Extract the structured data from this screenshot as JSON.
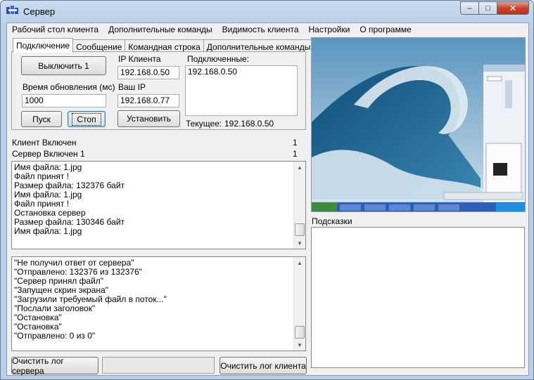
{
  "window": {
    "title": "Сервер"
  },
  "menu": [
    "Рабочий стол клиента",
    "Дополнительные команды",
    "Видимость клиента",
    "Настройки",
    "О программе"
  ],
  "tabs": [
    {
      "label": "Подключение",
      "active": true
    },
    {
      "label": "Сообщение",
      "active": false
    },
    {
      "label": "Командная строка",
      "active": false
    },
    {
      "label": "Дополнительные команды",
      "active": false
    }
  ],
  "connection": {
    "disable_button": "Выключить 1",
    "update_time_label": "Время обновления (мс)",
    "update_time_value": "1000",
    "start_button": "Пуск",
    "stop_button": "Стоп",
    "client_ip_label": "IP Клиента",
    "client_ip_value": "192.168.0.50",
    "your_ip_label": "Ваш IP",
    "your_ip_value": "192.168.0.77",
    "set_button": "Установить",
    "connected_label": "Подключенные:",
    "connected_items": [
      "192.168.0.50"
    ],
    "current_label": "Текущее:",
    "current_value": "192.168.0.50"
  },
  "status": {
    "client_label": "Клиент Включен",
    "client_value": "1",
    "server_label": "Сервер Включен 1",
    "server_value": "1"
  },
  "server_log": [
    "Имя файла: 1.jpg",
    "Файл принят !",
    "Размер файла: 132376 байт",
    "Имя файла: 1.jpg",
    "Файл принят !",
    "Остановка сервер",
    "Размер файла: 130346 байт",
    "Имя файла: 1.jpg"
  ],
  "client_log": [
    "\"Не получил ответ от сервера\"",
    "\"Отправлено: 132376 из 132376\"",
    "\"Сервер принял файл\"",
    "\"Запущен скрин экрана\"",
    "\"Загрузили требуемый файл в поток...\"",
    "\"Послали заголовок\"",
    "\"Остановка\"",
    "\"Остановка\"",
    "\"Отправлено: 0 из 0\""
  ],
  "buttons": {
    "clear_server_log": "Очистить лог сервера",
    "clear_client_log": "Очистить лог клиента"
  },
  "hints": {
    "label": "Подсказки"
  },
  "colors": {
    "title_bar": "#c9dcef",
    "close_button": "#c7432b",
    "wave_sky": "#2a6d9c"
  }
}
